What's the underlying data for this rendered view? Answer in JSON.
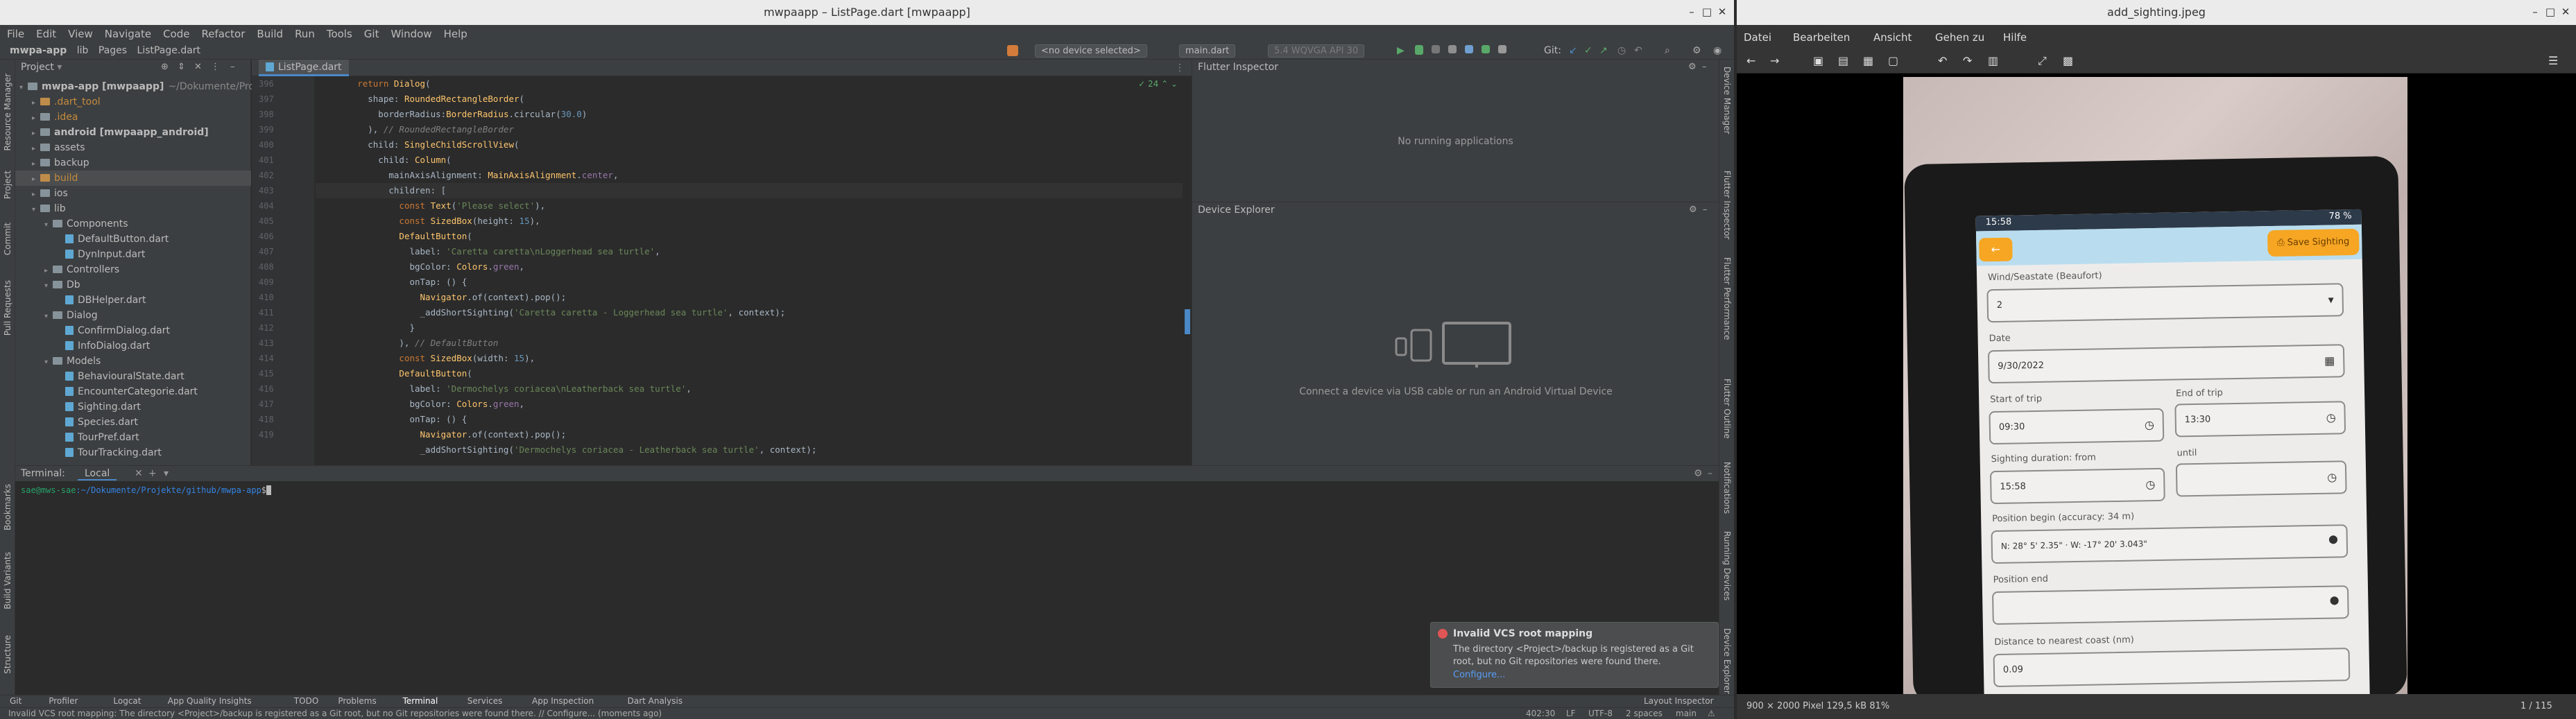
{
  "ide": {
    "window_title": "mwpaapp – ListPage.dart [mwpaapp]",
    "menu": [
      "File",
      "Edit",
      "View",
      "Navigate",
      "Code",
      "Refactor",
      "Build",
      "Run",
      "Tools",
      "Git",
      "Window",
      "Help"
    ],
    "breadcrumbs": [
      "mwpa-app",
      "lib",
      "Pages",
      "ListPage.dart"
    ],
    "device_selector": "<no device selected>",
    "run_config": "main.dart",
    "emulator": "5.4 WQVGA API 30",
    "git_label": "Git:",
    "project_label": "Project",
    "tree": [
      {
        "name": "mwpa-app [mwpaapp]",
        "extra": "~/Dokumente/Proj",
        "depth": 0,
        "arrow": "▾",
        "kind": "folder",
        "style": "bold"
      },
      {
        "name": ".dart_tool",
        "depth": 1,
        "arrow": "▸",
        "kind": "folder-orange",
        "style": "excluded"
      },
      {
        "name": ".idea",
        "depth": 1,
        "arrow": "▸",
        "kind": "folder",
        "style": "excluded"
      },
      {
        "name": "android [mwpaapp_android]",
        "depth": 1,
        "arrow": "▸",
        "kind": "folder",
        "style": "bold"
      },
      {
        "name": "assets",
        "depth": 1,
        "arrow": "▸",
        "kind": "folder",
        "style": ""
      },
      {
        "name": "backup",
        "depth": 1,
        "arrow": "▸",
        "kind": "folder",
        "style": ""
      },
      {
        "name": "build",
        "depth": 1,
        "arrow": "▸",
        "kind": "folder-orange",
        "style": "excluded",
        "selected": true
      },
      {
        "name": "ios",
        "depth": 1,
        "arrow": "▸",
        "kind": "folder",
        "style": ""
      },
      {
        "name": "lib",
        "depth": 1,
        "arrow": "▾",
        "kind": "folder",
        "style": ""
      },
      {
        "name": "Components",
        "depth": 2,
        "arrow": "▾",
        "kind": "folder",
        "style": ""
      },
      {
        "name": "DefaultButton.dart",
        "depth": 3,
        "arrow": "",
        "kind": "file",
        "style": ""
      },
      {
        "name": "DynInput.dart",
        "depth": 3,
        "arrow": "",
        "kind": "file",
        "style": ""
      },
      {
        "name": "Controllers",
        "depth": 2,
        "arrow": "▸",
        "kind": "folder",
        "style": ""
      },
      {
        "name": "Db",
        "depth": 2,
        "arrow": "▾",
        "kind": "folder",
        "style": ""
      },
      {
        "name": "DBHelper.dart",
        "depth": 3,
        "arrow": "",
        "kind": "file",
        "style": ""
      },
      {
        "name": "Dialog",
        "depth": 2,
        "arrow": "▾",
        "kind": "folder",
        "style": ""
      },
      {
        "name": "ConfirmDialog.dart",
        "depth": 3,
        "arrow": "",
        "kind": "file",
        "style": ""
      },
      {
        "name": "InfoDialog.dart",
        "depth": 3,
        "arrow": "",
        "kind": "file",
        "style": ""
      },
      {
        "name": "Models",
        "depth": 2,
        "arrow": "▾",
        "kind": "folder",
        "style": ""
      },
      {
        "name": "BehaviouralState.dart",
        "depth": 3,
        "arrow": "",
        "kind": "file",
        "style": ""
      },
      {
        "name": "EncounterCategorie.dart",
        "depth": 3,
        "arrow": "",
        "kind": "file",
        "style": ""
      },
      {
        "name": "Sighting.dart",
        "depth": 3,
        "arrow": "",
        "kind": "file",
        "style": ""
      },
      {
        "name": "Species.dart",
        "depth": 3,
        "arrow": "",
        "kind": "file",
        "style": ""
      },
      {
        "name": "TourPref.dart",
        "depth": 3,
        "arrow": "",
        "kind": "file",
        "style": ""
      },
      {
        "name": "TourTracking.dart",
        "depth": 3,
        "arrow": "",
        "kind": "file",
        "style": ""
      }
    ],
    "editor_tab": "ListPage.dart",
    "gutter": [
      "396",
      "397",
      "398",
      "399",
      "400",
      "401",
      "402",
      "403",
      "404",
      "405",
      "406",
      "407",
      "408",
      "409",
      "410",
      "411",
      "412",
      "413",
      "414",
      "415",
      "416",
      "417",
      "418",
      "419"
    ],
    "code_html": [
      "        <span class=\"kw\">return</span> <span class=\"cls\">Dialog</span>(",
      "          shape: <span class=\"cls\">RoundedRectangleBorder</span>(",
      "            borderRadius:<span class=\"cls\">BorderRadius</span>.circular(<span class=\"num\">30.0</span>)",
      "          ), <span class=\"cmt\">// RoundedRectangleBorder</span>",
      "          child: <span class=\"cls\">SingleChildScrollView</span>(",
      "            child: <span class=\"cls\">Column</span>(",
      "              mainAxisAlignment: <span class=\"cls\">MainAxisAlignment</span>.<span class=\"prm\">center</span>,",
      "              children: [",
      "                <span class=\"kw\">const</span> <span class=\"cls\">Text</span>(<span class=\"str\">'Please select'</span>),",
      "                <span class=\"kw\">const</span> <span class=\"cls\">SizedBox</span>(height: <span class=\"num\">15</span>),",
      "                <span class=\"cls\">DefaultButton</span>(",
      "                  label: <span class=\"str\">'Caretta caretta\\nLoggerhead sea turtle'</span>,",
      "                  bgColor: <span class=\"cls\">Colors</span>.<span class=\"prm\">green</span>,",
      "                  onTap: () {",
      "                    <span class=\"cls\">Navigator</span>.of(context).pop();",
      "                    _addShortSighting(<span class=\"str\">'Caretta caretta - Loggerhead sea turtle'</span>, context);",
      "                  }",
      "                ), <span class=\"cmt\">// DefaultButton</span>",
      "                <span class=\"kw\">const</span> <span class=\"cls\">SizedBox</span>(width: <span class=\"num\">15</span>),",
      "                <span class=\"cls\">DefaultButton</span>(",
      "                  label: <span class=\"str\">'Dermochelys coriacea\\nLeatherback sea turtle'</span>,",
      "                  bgColor: <span class=\"cls\">Colors</span>.<span class=\"prm\">green</span>,",
      "                  onTap: () {",
      "                    <span class=\"cls\">Navigator</span>.of(context).pop();",
      "                    _addShortSighting(<span class=\"str\">'Dermochelys coriacea - Leatherback sea turtle'</span>, context);"
    ],
    "inspection_count": "24",
    "flutter_inspector": {
      "title": "Flutter Inspector",
      "message": "No running applications"
    },
    "device_explorer": {
      "title": "Device Explorer",
      "message": "Connect a device via USB cable or run an Android Virtual Device"
    },
    "terminal": {
      "title": "Terminal:",
      "tab": "Local",
      "user": "sae@mws-sae",
      "path": ":~/Dokumente/Projekte/github/mwpa-app",
      "prompt_end": "$"
    },
    "notification": {
      "title": "Invalid VCS root mapping",
      "body": "The directory <Project>/backup is registered as a Git root, but no Git repositories were found there.",
      "link": "Configure..."
    },
    "bottom_tabs": [
      "Git",
      "Profiler",
      "Logcat",
      "App Quality Insights",
      "TODO",
      "Problems",
      "Terminal",
      "Services",
      "App Inspection",
      "Dart Analysis"
    ],
    "layout_inspector": "Layout Inspector",
    "status_message": "Invalid VCS root mapping: The directory <Project>/backup is registered as a Git root, but no Git repositories were found there. // Configure... (moments ago)",
    "status_right": [
      "402:30",
      "LF",
      "UTF-8",
      "2 spaces",
      "main",
      "⚠"
    ],
    "left_strip": [
      "Resource Manager",
      "Project",
      "Commit",
      "Pull Requests",
      "Bookmarks",
      "Build Variants",
      "Structure"
    ],
    "right_strip": [
      "Device Manager",
      "Flutter Inspector",
      "Flutter Performance",
      "Flutter Outline",
      "Notifications",
      "Running Devices",
      "Device Explorer"
    ]
  },
  "viewer": {
    "window_title": "add_sighting.jpeg",
    "menu": [
      "Datei",
      "Bearbeiten",
      "Ansicht",
      "Gehen zu",
      "Hilfe"
    ],
    "status_info": "900 × 2000 Pixel  129,5 kB  81%",
    "page_count": "1 / 115",
    "photo": {
      "status_time": "15:58",
      "status_battery": "78 %",
      "save_button": "Save Sighting",
      "fields": [
        {
          "label": "Wind/Seastate (Beaufort)",
          "value": "2",
          "icon": "▾"
        },
        {
          "label": "Date",
          "value": "9/30/2022",
          "icon": "▦"
        },
        {
          "label": "Start of trip",
          "value": "09:30",
          "icon": "◷"
        },
        {
          "label": "End of trip",
          "value": "13:30",
          "icon": "◷"
        },
        {
          "label": "Sighting duration: from",
          "value": "15:58",
          "icon": "◷"
        },
        {
          "label": "until",
          "value": "",
          "icon": "◷"
        },
        {
          "label": "Position begin (accuracy: 34 m)",
          "value": "N: 28° 5' 2.35\" · W: -17° 20' 3.043\"",
          "icon": "⬤"
        },
        {
          "label": "Position end",
          "value": "",
          "icon": "⬤"
        },
        {
          "label": "Distance to nearest coast (nm)",
          "value": "0.09",
          "icon": ""
        }
      ]
    }
  },
  "colors": {
    "ide_bg": "#2b2b2b",
    "panel_bg": "#3c3f41",
    "accent": "#4a88c7",
    "app_orange": "#f6a623",
    "app_bar": "#b9ddef"
  }
}
